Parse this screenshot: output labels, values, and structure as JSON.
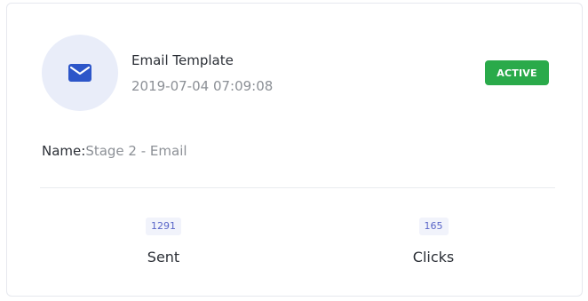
{
  "card": {
    "icon": "mail-icon",
    "title": "Email Template",
    "timestamp": "2019-07-04 07:09:08",
    "status": "ACTIVE",
    "name_label": "Name:",
    "name_value": "Stage 2 - Email",
    "stats": [
      {
        "value": "1291",
        "label": "Sent"
      },
      {
        "value": "165",
        "label": "Clicks"
      }
    ]
  },
  "colors": {
    "accent": "#2d56c9",
    "avatar_bg": "#e9edf9",
    "status_active": "#2aaa4a",
    "stat_value": "#5a66c8"
  }
}
